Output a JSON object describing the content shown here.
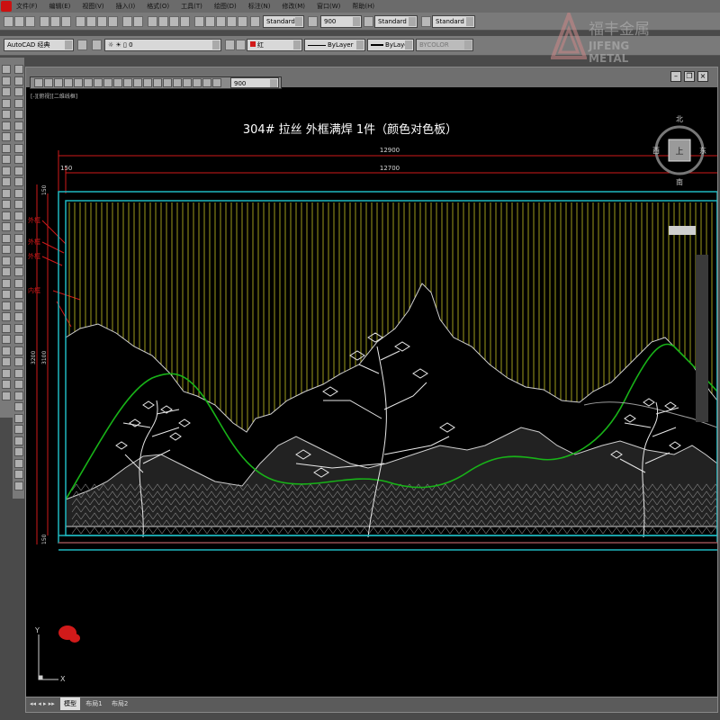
{
  "menubar": {
    "items": [
      "文件(F)",
      "编辑(E)",
      "视图(V)",
      "插入(I)",
      "格式(O)",
      "工具(T)",
      "绘图(D)",
      "标注(N)",
      "修改(M)",
      "窗口(W)",
      "帮助(H)"
    ]
  },
  "styles_toolbar": {
    "text_style": "Standard",
    "dim_scale": "900",
    "dim_style": "Standard",
    "table_style": "Standard"
  },
  "workspace_toolbar": {
    "workspace": "AutoCAD 经典",
    "layer": "0",
    "color": "红",
    "linetype": "ByLayer",
    "lineweight": "ByLayer",
    "plotstyle": "BYCOLOR"
  },
  "floating_toolbar": {
    "scale_value": "900"
  },
  "watermark": {
    "cn": "福丰金属",
    "en": "JIFENG METAL"
  },
  "viewport_label": "[-][俯视][二维线框]",
  "drawing": {
    "title": "304# 拉丝 外框满焊 1件（颜色对色板）",
    "dims": {
      "overall_width": "12900",
      "inner_width": "12700",
      "frame_offset_left": "150",
      "frame_offset_top": "150",
      "height_outer": "3200",
      "height_inner": "3100",
      "frame_offset_bottom": "150"
    },
    "left_notes": [
      "外框",
      "外框",
      "外框",
      "内框"
    ]
  },
  "viewcube": {
    "north": "北",
    "south": "南",
    "east": "东",
    "west": "西",
    "top": "上"
  },
  "ucs": {
    "x": "X",
    "y": "Y"
  },
  "tabs": [
    "模型",
    "布局1",
    "布局2"
  ],
  "colors": {
    "background": "#000000",
    "frame_cyan": "#1fb8c0",
    "dim_red": "#d11a1a",
    "hatch_yellow": "#9c9a1c",
    "mountain_line": "#cfcfcf",
    "green_curve": "#18b318"
  }
}
